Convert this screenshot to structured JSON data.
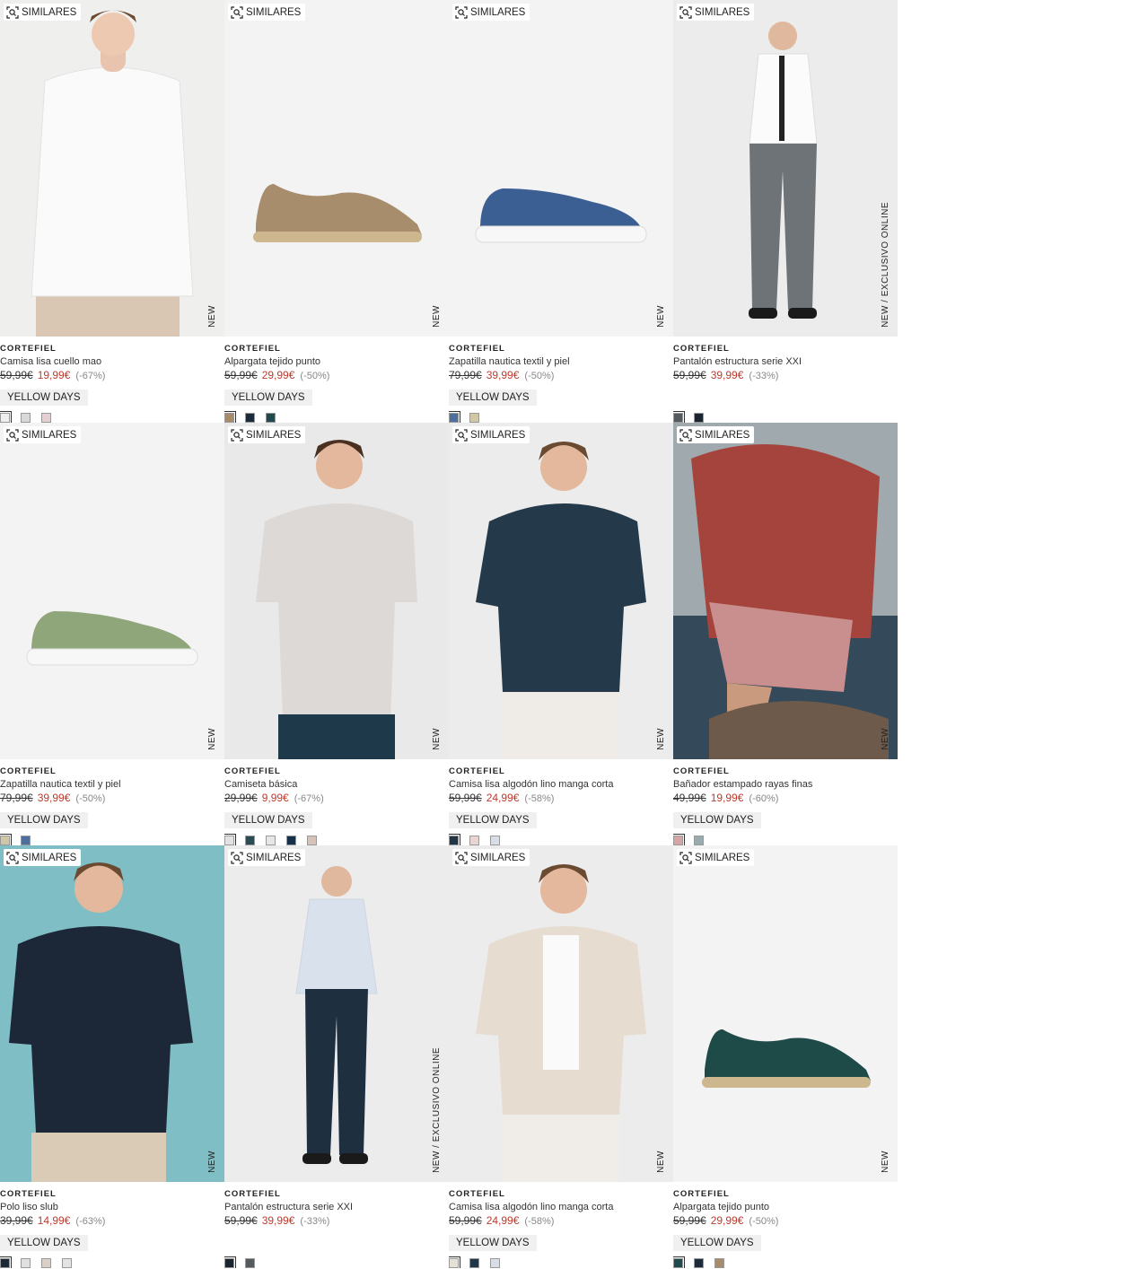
{
  "products": [
    {
      "brand": "CORTEFIEL",
      "name": "Camisa lisa cuello mao",
      "old_price": "59,99€",
      "price": "19,99€",
      "discount": "(-67%)",
      "promo": "YELLOW DAYS",
      "similar_label": "SIMILARES",
      "tag": "NEW",
      "swatches": [
        "#eeeeee",
        "#d8d8d8",
        "#e6cfd2"
      ],
      "image": "shirt-white"
    },
    {
      "brand": "CORTEFIEL",
      "name": "Alpargata tejido punto",
      "old_price": "59,99€",
      "price": "29,99€",
      "discount": "(-50%)",
      "promo": "YELLOW DAYS",
      "similar_label": "SIMILARES",
      "tag": "NEW",
      "swatches": [
        "#a88b69",
        "#1c2a3a",
        "#1f4a4e"
      ],
      "image": "espadrille-beige"
    },
    {
      "brand": "CORTEFIEL",
      "name": "Zapatilla nautica textil y piel",
      "old_price": "79,99€",
      "price": "39,99€",
      "discount": "(-50%)",
      "promo": "YELLOW DAYS",
      "similar_label": "SIMILARES",
      "tag": "NEW",
      "swatches": [
        "#4e6e9c",
        "#cfc7a6"
      ],
      "image": "boat-shoe-blue"
    },
    {
      "brand": "CORTEFIEL",
      "name": "Pantalón estructura serie XXI",
      "old_price": "59,99€",
      "price": "39,99€",
      "discount": "(-33%)",
      "promo": "",
      "similar_label": "SIMILARES",
      "tag": "NEW / EXCLUSIVO ONLINE",
      "swatches": [
        "#555a5e",
        "#1a2530"
      ],
      "image": "suit-grey"
    },
    {
      "brand": "CORTEFIEL",
      "name": "Zapatilla nautica textil y piel",
      "old_price": "79,99€",
      "price": "39,99€",
      "discount": "(-50%)",
      "promo": "YELLOW DAYS",
      "similar_label": "SIMILARES",
      "tag": "NEW",
      "swatches": [
        "#cfc7a6",
        "#4e6e9c"
      ],
      "image": "boat-shoe-green"
    },
    {
      "brand": "CORTEFIEL",
      "name": "Camiseta básica",
      "old_price": "29,99€",
      "price": "9,99€",
      "discount": "(-67%)",
      "promo": "YELLOW DAYS",
      "similar_label": "SIMILARES",
      "tag": "NEW",
      "swatches": [
        "#e2e2e2",
        "#2b4a52",
        "#e6e6e6",
        "#16304a",
        "#d6c3b8"
      ],
      "image": "tee-grey"
    },
    {
      "brand": "CORTEFIEL",
      "name": "Camisa lisa algodón lino manga corta",
      "old_price": "59,99€",
      "price": "24,99€",
      "discount": "(-58%)",
      "promo": "YELLOW DAYS",
      "similar_label": "SIMILARES",
      "tag": "NEW",
      "swatches": [
        "#203647",
        "#ead5d5",
        "#d9dde5"
      ],
      "image": "shirt-navy"
    },
    {
      "brand": "CORTEFIEL",
      "name": "Bañador estampado rayas finas",
      "old_price": "49,99€",
      "price": "19,99€",
      "discount": "(-60%)",
      "promo": "YELLOW DAYS",
      "similar_label": "SIMILARES",
      "tag": "NEW",
      "swatches": [
        "#d6a6a6",
        "#9aabad"
      ],
      "image": "swim-red"
    },
    {
      "brand": "CORTEFIEL",
      "name": "Polo liso slub",
      "old_price": "39,99€",
      "price": "14,99€",
      "discount": "(-63%)",
      "promo": "YELLOW DAYS",
      "similar_label": "SIMILARES",
      "tag": "NEW",
      "swatches": [
        "#1b2838",
        "#e0e0e0",
        "#d9cfc4",
        "#e3e3e3"
      ],
      "image": "polo-navy"
    },
    {
      "brand": "CORTEFIEL",
      "name": "Pantalón estructura serie XXI",
      "old_price": "59,99€",
      "price": "39,99€",
      "discount": "(-33%)",
      "promo": "",
      "similar_label": "SIMILARES",
      "tag": "NEW / EXCLUSIVO ONLINE",
      "swatches": [
        "#1a2530",
        "#555a5e"
      ],
      "image": "suit-navy"
    },
    {
      "brand": "CORTEFIEL",
      "name": "Camisa lisa algodón lino manga corta",
      "old_price": "59,99€",
      "price": "24,99€",
      "discount": "(-58%)",
      "promo": "YELLOW DAYS",
      "similar_label": "SIMILARES",
      "tag": "NEW",
      "swatches": [
        "#e6e1d6",
        "#203647",
        "#d9dde5"
      ],
      "image": "shirt-beige"
    },
    {
      "brand": "CORTEFIEL",
      "name": "Alpargata tejido punto",
      "old_price": "59,99€",
      "price": "29,99€",
      "discount": "(-50%)",
      "promo": "YELLOW DAYS",
      "similar_label": "SIMILARES",
      "tag": "NEW",
      "swatches": [
        "#1f4a4e",
        "#1c2a3a",
        "#a88b69"
      ],
      "image": "espadrille-green"
    }
  ]
}
